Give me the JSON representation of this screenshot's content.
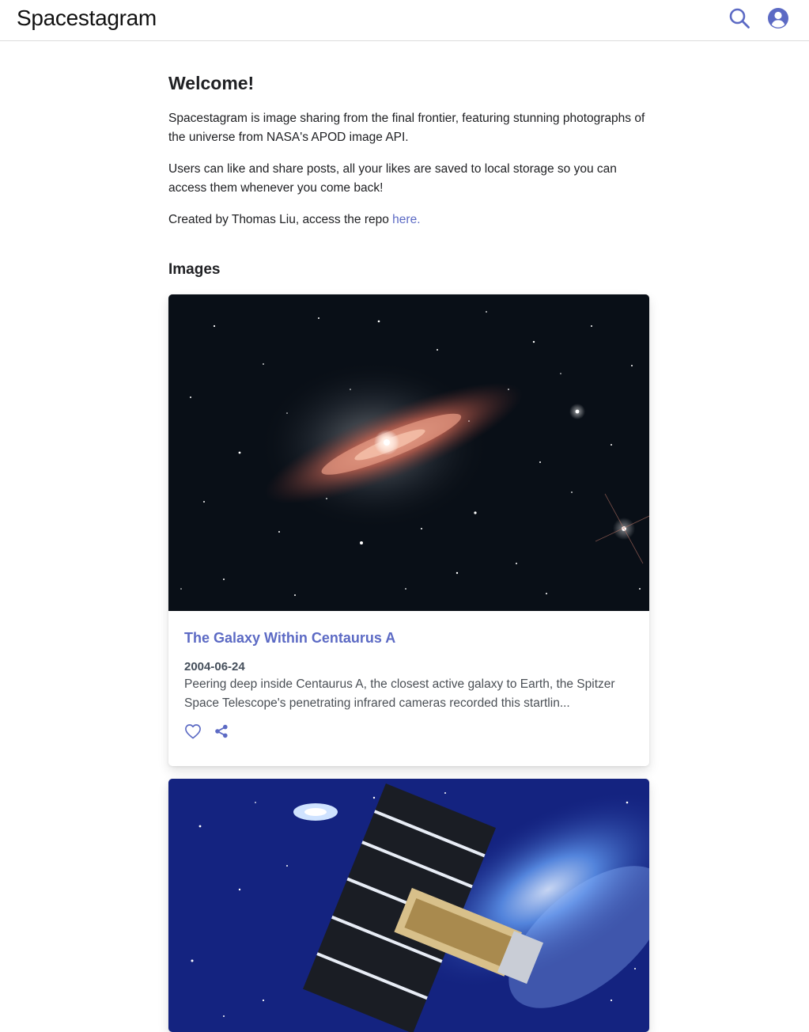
{
  "header": {
    "brand": "Spacestagram",
    "search_icon": "search-icon",
    "account_icon": "user-circle-icon"
  },
  "intro": {
    "title": "Welcome!",
    "p1": "Spacestagram is image sharing from the final frontier, featuring stunning photographs of the universe from NASA's APOD image API.",
    "p2": "Users can like and share posts, all your likes are saved to local storage so you can access them whenever you come back!",
    "p3_prefix": "Created by Thomas Liu, access the repo ",
    "p3_link": "here."
  },
  "images_heading": "Images",
  "posts": [
    {
      "title": "The Galaxy Within Centaurus A",
      "date": "2004-06-24",
      "description": "Peering deep inside Centaurus A, the closest active galaxy to Earth, the Spitzer Space Telescope's penetrating infrared cameras recorded this startlin...",
      "like_icon": "heart-outline-icon",
      "share_icon": "share-icon"
    },
    {
      "image": "satellite-over-blue-starfield"
    }
  ],
  "colors": {
    "accent": "#5c6ac4",
    "text": "#202124",
    "muted": "#4a4f55",
    "date": "#454f5b"
  }
}
